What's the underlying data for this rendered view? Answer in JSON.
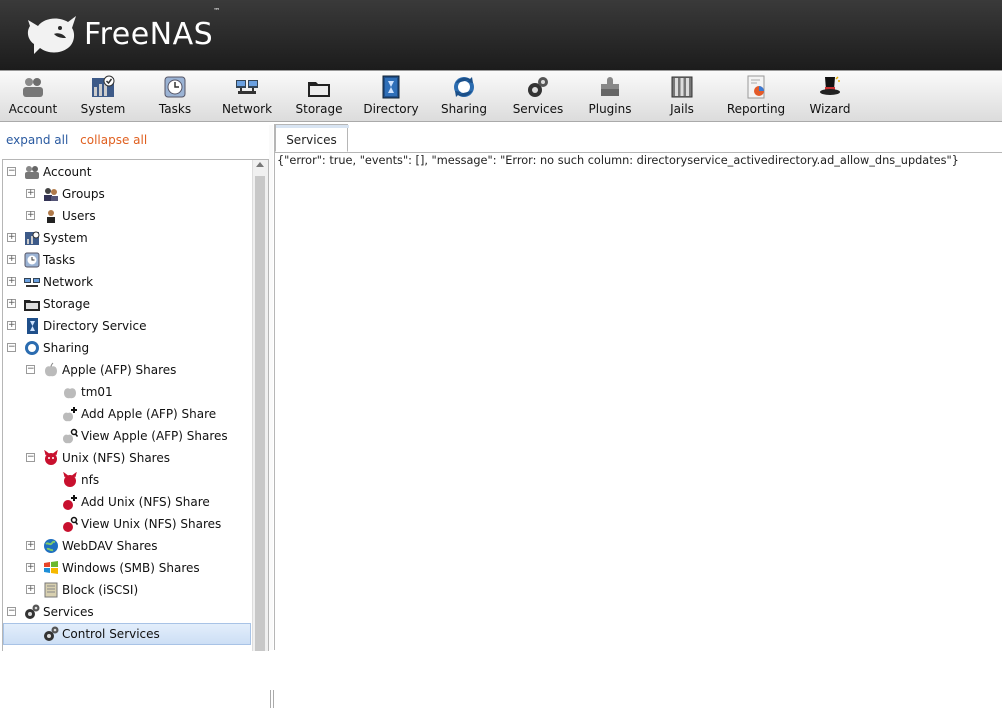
{
  "header": {
    "logo_text": "FreeNAS",
    "logo_tm": "™"
  },
  "toolbar": {
    "items": [
      {
        "label": "Account",
        "icon": "account-icon"
      },
      {
        "label": "System",
        "icon": "system-icon"
      },
      {
        "label": "Tasks",
        "icon": "tasks-icon"
      },
      {
        "label": "Network",
        "icon": "network-icon"
      },
      {
        "label": "Storage",
        "icon": "storage-icon"
      },
      {
        "label": "Directory",
        "icon": "directory-icon"
      },
      {
        "label": "Sharing",
        "icon": "sharing-icon"
      },
      {
        "label": "Services",
        "icon": "services-icon"
      },
      {
        "label": "Plugins",
        "icon": "plugins-icon"
      },
      {
        "label": "Jails",
        "icon": "jails-icon"
      },
      {
        "label": "Reporting",
        "icon": "reporting-icon"
      },
      {
        "label": "Wizard",
        "icon": "wizard-icon"
      }
    ]
  },
  "tree_controls": {
    "expand_all": "expand all",
    "collapse_all": "collapse all"
  },
  "tree": {
    "nodes": [
      {
        "label": "Account",
        "expander": "−"
      },
      {
        "label": "Groups",
        "expander": "+"
      },
      {
        "label": "Users",
        "expander": "+"
      },
      {
        "label": "System",
        "expander": "+"
      },
      {
        "label": "Tasks",
        "expander": "+"
      },
      {
        "label": "Network",
        "expander": "+"
      },
      {
        "label": "Storage",
        "expander": "+"
      },
      {
        "label": "Directory Service",
        "expander": "+"
      },
      {
        "label": "Sharing",
        "expander": "−"
      },
      {
        "label": "Apple (AFP) Shares",
        "expander": "−"
      },
      {
        "label": "tm01",
        "expander": ""
      },
      {
        "label": "Add Apple (AFP) Share",
        "expander": ""
      },
      {
        "label": "View Apple (AFP) Shares",
        "expander": ""
      },
      {
        "label": "Unix (NFS) Shares",
        "expander": "−"
      },
      {
        "label": "nfs",
        "expander": ""
      },
      {
        "label": "Add Unix (NFS) Share",
        "expander": ""
      },
      {
        "label": "View Unix (NFS) Shares",
        "expander": ""
      },
      {
        "label": "WebDAV Shares",
        "expander": "+"
      },
      {
        "label": "Windows (SMB) Shares",
        "expander": "+"
      },
      {
        "label": "Block (iSCSI)",
        "expander": "+"
      },
      {
        "label": "Services",
        "expander": "−"
      },
      {
        "label": "Control Services",
        "expander": ""
      }
    ]
  },
  "content": {
    "tab_label": "Services",
    "body_text": "{\"error\": true, \"events\": [], \"message\": \"Error: no such column: directoryservice_activedirectory.ad_allow_dns_updates\"}"
  },
  "colors": {
    "link_blue": "#2a5aa0",
    "link_orange": "#e06020",
    "selection": "#cddff5"
  }
}
